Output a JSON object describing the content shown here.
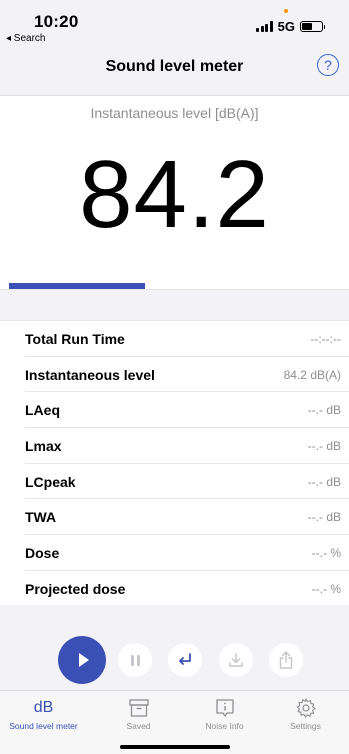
{
  "status_bar": {
    "time": "10:20",
    "back_label": "◂ Search",
    "network": "5G"
  },
  "nav": {
    "title": "Sound level meter",
    "help_symbol": "?"
  },
  "meter": {
    "label": "Instantaneous level [dB(A)]",
    "value": "84.2",
    "progress_fraction": 0.4
  },
  "stats": [
    {
      "name": "Total Run Time",
      "value": "--:--:--"
    },
    {
      "name": "Instantaneous level",
      "value": "84.2 dB(A)"
    },
    {
      "name": "LAeq",
      "value": "--.- dB"
    },
    {
      "name": "Lmax",
      "value": "--.- dB"
    },
    {
      "name": "LCpeak",
      "value": "--.- dB"
    },
    {
      "name": "TWA",
      "value": "--.- dB"
    },
    {
      "name": "Dose",
      "value": "--.- %"
    },
    {
      "name": "Projected dose",
      "value": "--.- %"
    }
  ],
  "controls": {
    "play_icon": "play-icon",
    "pause_icon": "pause-icon",
    "enter_icon": "return-icon",
    "download_icon": "download-icon",
    "share_icon": "share-icon"
  },
  "tabs": [
    {
      "label": "Sound level meter",
      "icon": "dB",
      "active": true
    },
    {
      "label": "Saved",
      "icon": "archive-icon",
      "active": false
    },
    {
      "label": "Noise Info",
      "icon": "info-icon",
      "active": false
    },
    {
      "label": "Settings",
      "icon": "gear-icon",
      "active": false
    }
  ],
  "colors": {
    "accent": "#3a50b4",
    "help": "#3a5fcd",
    "muted": "#8e8e93",
    "background_gray": "#f2f2f7"
  }
}
